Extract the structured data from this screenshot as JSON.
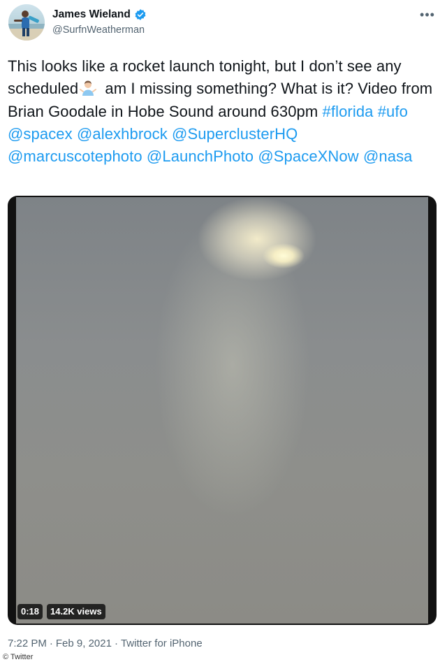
{
  "author": {
    "display_name": "James Wieland",
    "handle": "@SurfnWeatherman",
    "verified": true
  },
  "icons": {
    "verified": "verified-badge-icon",
    "more": "more-options-icon",
    "emoji": "man-shrugging-emoji"
  },
  "tweet": {
    "text_part1": "This looks like a rocket launch tonight, but I don’t see any scheduled",
    "text_part2": " am I missing something? What is it? Video from Brian Goodale in Hobe Sound around 630pm ",
    "hashtags": [
      "#florida",
      "#ufo"
    ],
    "mentions": [
      "@spacex",
      "@alexhbrock",
      "@SuperclusterHQ",
      "@marcuscotephoto",
      "@LaunchPhoto",
      "@SpaceXNow",
      "@nasa"
    ]
  },
  "video": {
    "duration": "0:18",
    "views": "14.2K views"
  },
  "meta": {
    "time": "7:22 PM",
    "separator": "·",
    "date": "Feb 9, 2021",
    "source": "Twitter for iPhone"
  },
  "watermark": "© Twitter",
  "colors": {
    "link": "#1d9bf0",
    "text": "#0f1419",
    "secondary": "#536471",
    "verified": "#1d9bf0"
  }
}
